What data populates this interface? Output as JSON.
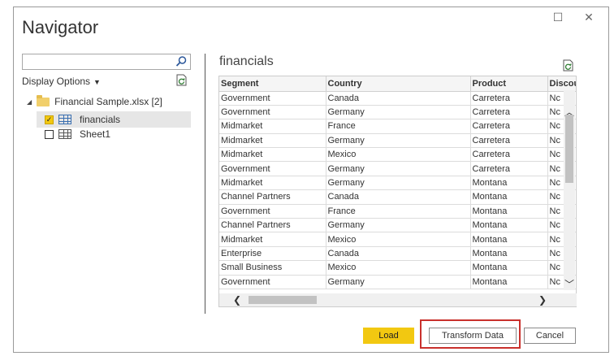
{
  "window": {
    "title": "Navigator",
    "minimize_glyph": "☐",
    "close_glyph": "✕"
  },
  "left_pane": {
    "search": {
      "value": "",
      "placeholder": ""
    },
    "display_options_label": "Display Options",
    "tree": {
      "root_label": "Financial Sample.xlsx [2]",
      "items": [
        {
          "label": "financials",
          "checked": true,
          "selected": true
        },
        {
          "label": "Sheet1",
          "checked": false,
          "selected": false
        }
      ]
    }
  },
  "preview": {
    "title": "financials",
    "columns": [
      "Segment",
      "Country",
      "Product",
      "Discou"
    ],
    "rows": [
      [
        "Government",
        "Canada",
        "Carretera",
        "Nc"
      ],
      [
        "Government",
        "Germany",
        "Carretera",
        "Nc"
      ],
      [
        "Midmarket",
        "France",
        "Carretera",
        "Nc"
      ],
      [
        "Midmarket",
        "Germany",
        "Carretera",
        "Nc"
      ],
      [
        "Midmarket",
        "Mexico",
        "Carretera",
        "Nc"
      ],
      [
        "Government",
        "Germany",
        "Carretera",
        "Nc"
      ],
      [
        "Midmarket",
        "Germany",
        "Montana",
        "Nc"
      ],
      [
        "Channel Partners",
        "Canada",
        "Montana",
        "Nc"
      ],
      [
        "Government",
        "France",
        "Montana",
        "Nc"
      ],
      [
        "Channel Partners",
        "Germany",
        "Montana",
        "Nc"
      ],
      [
        "Midmarket",
        "Mexico",
        "Montana",
        "Nc"
      ],
      [
        "Enterprise",
        "Canada",
        "Montana",
        "Nc"
      ],
      [
        "Small Business",
        "Mexico",
        "Montana",
        "Nc"
      ],
      [
        "Government",
        "Germany",
        "Montana",
        "Nc"
      ]
    ]
  },
  "buttons": {
    "load": "Load",
    "transform": "Transform Data",
    "cancel": "Cancel"
  },
  "colors": {
    "accent_yellow": "#f2c811",
    "highlight_red": "#c9302c"
  }
}
